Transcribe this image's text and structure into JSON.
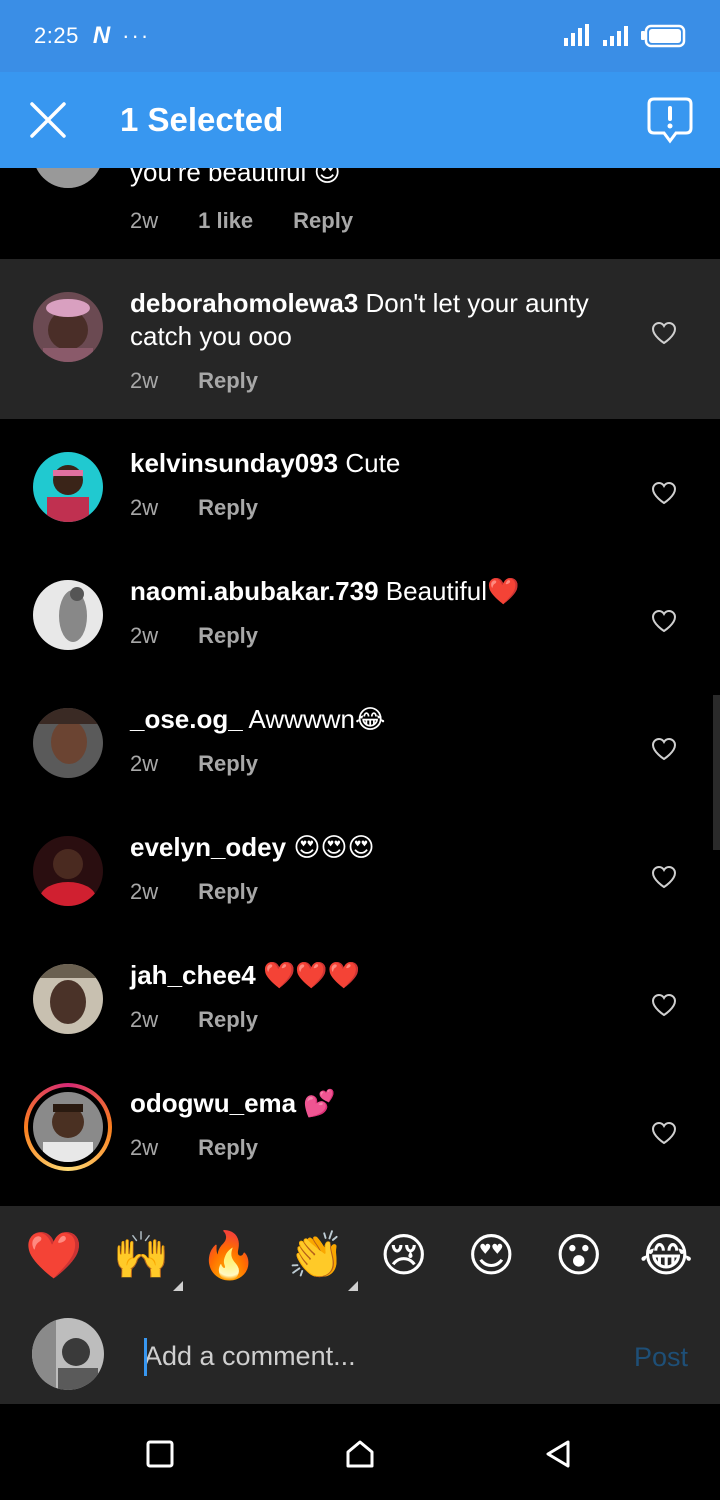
{
  "status_bar": {
    "time": "2:25",
    "app_glyph": "N",
    "dots": "···"
  },
  "header": {
    "title": "1 Selected"
  },
  "comments": [
    {
      "username": "",
      "text": "you’re beautiful",
      "emoji": "😍",
      "time": "2w",
      "likes": "1 like",
      "reply": "Reply",
      "selected": false
    },
    {
      "username": "deborahomolewa3",
      "text": "Don't let your aunty catch you ooo",
      "emoji": "",
      "time": "2w",
      "reply": "Reply",
      "selected": true
    },
    {
      "username": "kelvinsunday093",
      "text": "Cute",
      "emoji": "",
      "time": "2w",
      "reply": "Reply",
      "selected": false
    },
    {
      "username": "naomi.abubakar.739",
      "text": "Beautiful",
      "emoji": "❤️",
      "time": "2w",
      "reply": "Reply",
      "selected": false
    },
    {
      "username": "_ose.og_",
      "text": "Awwwwn",
      "emoji": "😂",
      "time": "2w",
      "reply": "Reply",
      "selected": false
    },
    {
      "username": "evelyn_odey",
      "text": "",
      "emoji": "😍😍😍",
      "time": "2w",
      "reply": "Reply",
      "selected": false
    },
    {
      "username": "jah_chee4",
      "text": "",
      "emoji": "❤️❤️❤️",
      "time": "2w",
      "reply": "Reply",
      "selected": false
    },
    {
      "username": "odogwu_ema",
      "text": "",
      "emoji": "💕",
      "time": "2w",
      "reply": "Reply",
      "selected": false
    }
  ],
  "reactions": [
    "❤️",
    "🙌",
    "🔥",
    "👏",
    "😢",
    "😍",
    "😮",
    "😂"
  ],
  "composer": {
    "placeholder": "Add a comment...",
    "post_label": "Post"
  },
  "colors": {
    "accent": "#3897f0",
    "status_bar": "#3a8ee6",
    "selected_row": "#262626",
    "muted": "#a8a8a8",
    "post_disabled": "#1e4f77"
  }
}
